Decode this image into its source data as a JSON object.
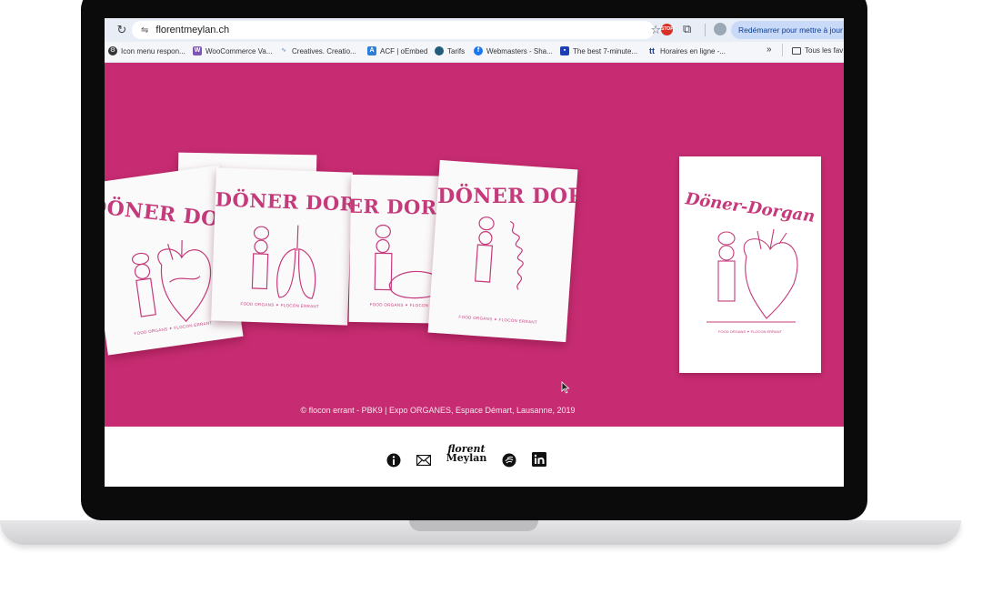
{
  "browser": {
    "url": "florentmeylan.ch",
    "update_button": "Redémarrer pour mettre à jour",
    "bookmarks": [
      {
        "label": "Icon menu respon...",
        "icon": "gear-icon",
        "color": "#333333"
      },
      {
        "label": "WooCommerce Va...",
        "icon": "woocommerce-icon",
        "color": "#7f54b3"
      },
      {
        "label": "Creatives. Creatio...",
        "icon": "wave-icon",
        "color": "#8aa0b8"
      },
      {
        "label": "ACF | oEmbed",
        "icon": "acf-icon",
        "color": "#2d7ed6"
      },
      {
        "label": "Tarifs",
        "icon": "globe-icon",
        "color": "#245a7a"
      },
      {
        "label": "Webmasters - Sha...",
        "icon": "facebook-icon",
        "color": "#1877f2"
      },
      {
        "label": "The best 7-minute...",
        "icon": "bookmark-blue-icon",
        "color": "#1a3fb5"
      },
      {
        "label": "Horaires en ligne -...",
        "icon": "tt-icon",
        "color": "#1f3c88"
      }
    ],
    "more_bookmarks": "»",
    "all_bookmarks": "Tous les fav"
  },
  "hero": {
    "background": "#c72c72",
    "bag_brand": "DÖNER DORGAN",
    "bag_tagline": "FOOD ORGANS ✦ FLOCON ERRANT",
    "poster_title": "Döner-Dorgan",
    "poster_tagline": "FOOD ORGANS ✦ FLOCON ERRANT",
    "caption": "© flocon errant - PBK9 | Expo ORGANES, Espace Démart, Lausanne, 2019"
  },
  "footer": {
    "logo_line1": "florent",
    "logo_line2": "Meylan",
    "icons": [
      "info-icon",
      "mail-icon",
      "logo",
      "music-icon",
      "linkedin-icon"
    ]
  }
}
